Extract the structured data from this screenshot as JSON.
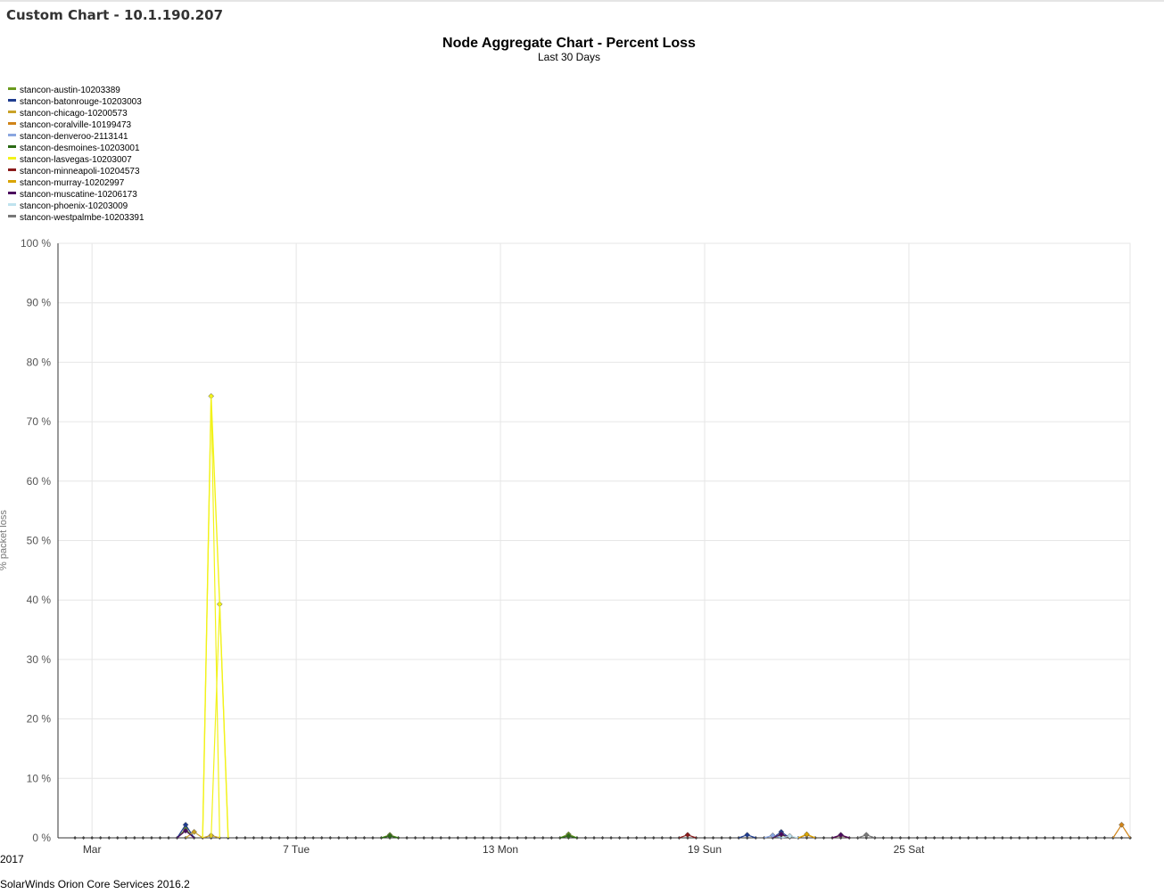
{
  "page": {
    "title": "Custom Chart - 10.1.190.207",
    "year_label": "2017",
    "footer": "SolarWinds Orion Core Services 2016.2"
  },
  "chart_data": {
    "type": "line",
    "title": "Node Aggregate Chart - Percent Loss",
    "subtitle": "Last 30 Days",
    "xlabel": "",
    "ylabel": "% packet loss",
    "x_ticks": [
      "Mar",
      "7 Tue",
      "13 Mon",
      "19 Sun",
      "25 Sat"
    ],
    "x_tick_days": [
      1,
      7,
      13,
      19,
      25
    ],
    "xlim": [
      0.0,
      31.5
    ],
    "ylim": [
      0,
      100
    ],
    "y_ticks": [
      0,
      10,
      20,
      30,
      40,
      50,
      60,
      70,
      80,
      90,
      100
    ],
    "y_tick_labels": [
      "0 %",
      "10 %",
      "20 %",
      "30 %",
      "40 %",
      "50 %",
      "60 %",
      "70 %",
      "80 %",
      "90 %",
      "100 %"
    ],
    "grid": true,
    "legend_position": "top-left",
    "sample_interval_days": 0.25,
    "series": [
      {
        "name": "stancon-austin-10203389",
        "color": "#6b9a1e",
        "peaks": [
          [
            3.75,
            1.5
          ],
          [
            9.75,
            0.5
          ],
          [
            15.0,
            0.6
          ],
          [
            21.25,
            0.5
          ]
        ]
      },
      {
        "name": "stancon-batonrouge-10203003",
        "color": "#1f3c8f",
        "peaks": [
          [
            3.75,
            2.2
          ],
          [
            20.25,
            0.5
          ],
          [
            21.25,
            1.0
          ]
        ]
      },
      {
        "name": "stancon-chicago-10200573",
        "color": "#c9a227",
        "peaks": [
          [
            4.0,
            1.0
          ],
          [
            4.5,
            0.4
          ]
        ]
      },
      {
        "name": "stancon-coralville-10199473",
        "color": "#d08418",
        "peaks": [
          [
            22.0,
            0.5
          ],
          [
            31.25,
            2.2
          ]
        ]
      },
      {
        "name": "stancon-denveroo-2113141",
        "color": "#8aa6e0",
        "peaks": [
          [
            21.0,
            0.4
          ]
        ]
      },
      {
        "name": "stancon-desmoines-10203001",
        "color": "#2a6a14",
        "peaks": [
          [
            9.75,
            0.3
          ],
          [
            15.0,
            0.3
          ]
        ]
      },
      {
        "name": "stancon-lasvegas-10203007",
        "color": "#f2f21a",
        "peaks": [
          [
            4.5,
            74.3
          ],
          [
            4.75,
            39.3
          ]
        ]
      },
      {
        "name": "stancon-minneapoli-10204573",
        "color": "#8b1a1a",
        "peaks": [
          [
            18.5,
            0.5
          ],
          [
            23.0,
            0.4
          ]
        ]
      },
      {
        "name": "stancon-murray-10202997",
        "color": "#d9a400",
        "peaks": [
          [
            22.0,
            0.6
          ]
        ]
      },
      {
        "name": "stancon-muscatine-10206173",
        "color": "#4b0a5e",
        "peaks": [
          [
            3.75,
            1.2
          ],
          [
            21.25,
            0.6
          ],
          [
            23.0,
            0.5
          ]
        ]
      },
      {
        "name": "stancon-phoenix-10203009",
        "color": "#bfe3ef",
        "peaks": [
          [
            21.5,
            0.3
          ]
        ]
      },
      {
        "name": "stancon-westpalmbe-10203391",
        "color": "#777777",
        "peaks": [
          [
            23.75,
            0.5
          ]
        ]
      }
    ]
  }
}
